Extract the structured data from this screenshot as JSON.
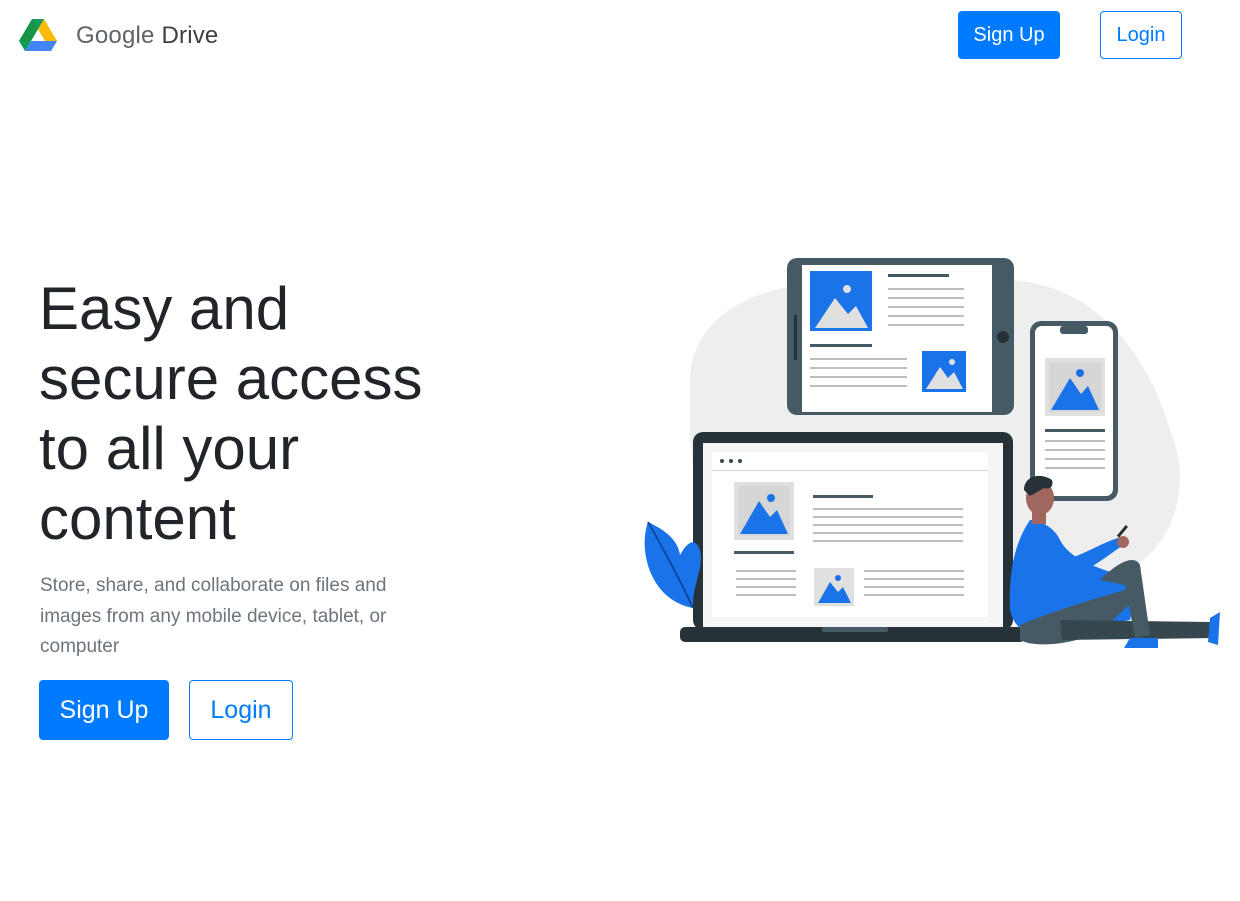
{
  "brand": {
    "google": "Google",
    "drive": "Drive",
    "logo_icon": "google-drive-logo-icon"
  },
  "nav": {
    "signup_label": "Sign Up",
    "login_label": "Login"
  },
  "hero": {
    "title": "Easy and secure access to all your content",
    "subtitle": "Store, share, and collaborate on files and images from any mobile device, tablet, or computer",
    "signup_label": "Sign Up",
    "login_label": "Login"
  },
  "colors": {
    "primary": "#007bff",
    "text": "#212529",
    "muted": "#6c757d",
    "accent_blue": "#1a73e8",
    "device_dark": "#37474f"
  }
}
